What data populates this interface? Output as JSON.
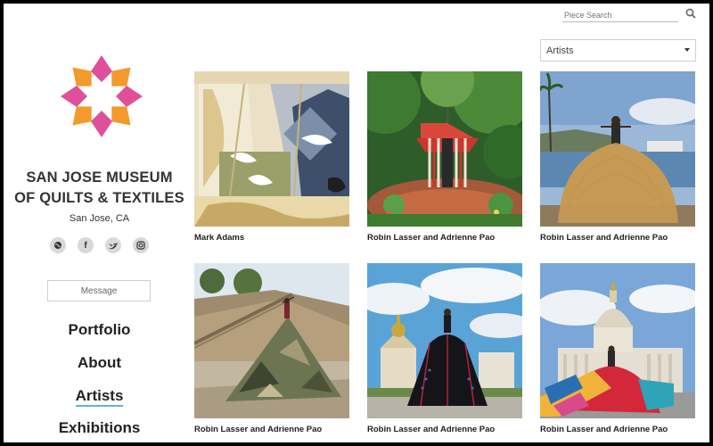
{
  "search": {
    "placeholder": "Piece Search"
  },
  "filter": {
    "selected": "Artists"
  },
  "sidebar": {
    "title_line1": "SAN JOSE MUSEUM",
    "title_line2": "OF QUILTS & TEXTILES",
    "location": "San Jose, CA",
    "social": [
      "website-icon",
      "facebook-icon",
      "twitter-icon",
      "instagram-icon"
    ],
    "message_label": "Message",
    "nav": [
      {
        "label": "Portfolio",
        "active": false
      },
      {
        "label": "About",
        "active": false
      },
      {
        "label": "Artists",
        "active": true
      },
      {
        "label": "Exhibitions",
        "active": false
      }
    ]
  },
  "colors": {
    "accent": "#5bb7d6",
    "logo_orange": "#f39a2c",
    "logo_pink": "#e0509a"
  },
  "pieces": [
    {
      "artist": "Mark Adams"
    },
    {
      "artist": "Robin Lasser and Adrienne Pao"
    },
    {
      "artist": "Robin Lasser and Adrienne Pao"
    },
    {
      "artist": "Robin Lasser and Adrienne Pao"
    },
    {
      "artist": "Robin Lasser and Adrienne Pao"
    },
    {
      "artist": "Robin Lasser and Adrienne Pao"
    }
  ]
}
